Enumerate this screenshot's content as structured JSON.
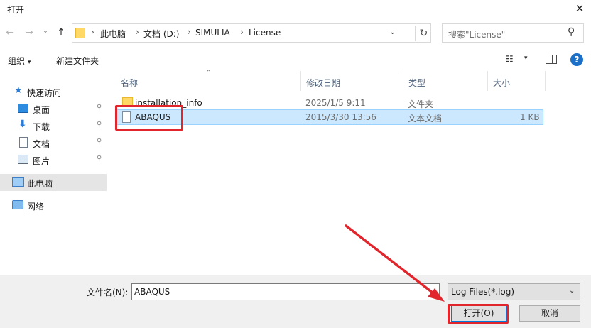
{
  "window": {
    "title": "打开"
  },
  "icons": {
    "close": "✕",
    "back": "←",
    "forward": "→",
    "recent": "⌄",
    "up": "↑",
    "sep": "›",
    "dropdown": "⌄",
    "refresh": "↻",
    "search": "⚲",
    "caret": "▾",
    "view": "☷",
    "help": "?",
    "pin": "⚲",
    "sort": "⌃",
    "select": "⌄"
  },
  "address": {
    "crumbs": [
      "此电脑",
      "文档 (D:)",
      "SIMULIA",
      "License"
    ]
  },
  "search": {
    "placeholder": "搜索\"License\""
  },
  "toolbar": {
    "organize": "组织",
    "new_folder": "新建文件夹"
  },
  "sidebar": {
    "items": [
      {
        "label": "快速访问"
      },
      {
        "label": "桌面"
      },
      {
        "label": "下载"
      },
      {
        "label": "文档"
      },
      {
        "label": "图片"
      },
      {
        "label": "此电脑"
      },
      {
        "label": "网络"
      }
    ]
  },
  "columns": {
    "name": "名称",
    "date": "修改日期",
    "type": "类型",
    "size": "大小"
  },
  "files": [
    {
      "name": "installation_info",
      "date": "2025/1/5 9:11",
      "type": "文件夹",
      "size": ""
    },
    {
      "name": "ABAQUS",
      "date": "2015/3/30 13:56",
      "type": "文本文档",
      "size": "1 KB"
    }
  ],
  "bottom": {
    "filename_label": "文件名(N):",
    "filename_value": "ABAQUS",
    "filetype": "Log Files(*.log)",
    "open": "打开(O)",
    "cancel": "取消"
  },
  "colors": {
    "selection": "#cce8ff",
    "selection_border": "#99d1ff",
    "annotation": "#e0262c",
    "accent": "#0078d7"
  }
}
